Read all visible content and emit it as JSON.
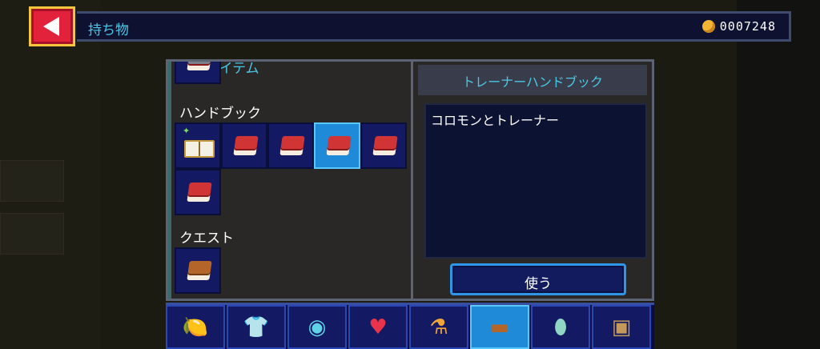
{
  "header": {
    "title": "持ち物",
    "coins": "0007248"
  },
  "inventory": {
    "sections": [
      {
        "label": "キーアイテム"
      },
      {
        "label": "ハンドブック"
      },
      {
        "label": "クエスト"
      }
    ]
  },
  "detail": {
    "item_name": "トレーナーハンドブック",
    "description": "コロモンとトレーナー",
    "use_label": "使う"
  },
  "tabs": [
    {
      "icon": "fruit-items-icon"
    },
    {
      "icon": "shirt-icon"
    },
    {
      "icon": "gems-icon"
    },
    {
      "icon": "heart-apple-icon"
    },
    {
      "icon": "potion-icon"
    },
    {
      "icon": "book-icon",
      "active": true
    },
    {
      "icon": "capsule-icon"
    },
    {
      "icon": "mystery-box-icon"
    }
  ],
  "colors": {
    "accent": "#49c8e6",
    "selected_slot": "#1e8ad8",
    "slot": "#131a63",
    "back_button": "#e2213a"
  }
}
